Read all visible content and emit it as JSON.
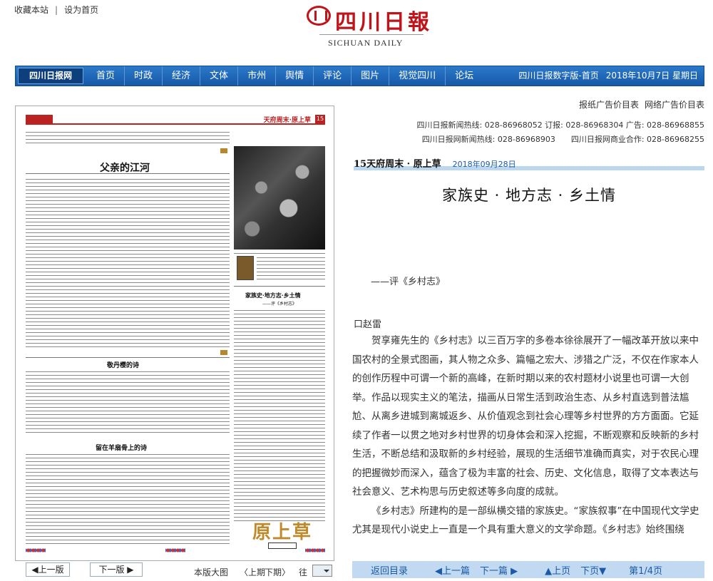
{
  "top_links": {
    "bookmark": "收藏本站",
    "separator": "|",
    "set_home": "设为首页"
  },
  "logo": {
    "cn": "四川日報",
    "en": "SICHUAN DAILY"
  },
  "nav": {
    "brand": "四川日报网",
    "items": [
      "首页",
      "时政",
      "经济",
      "文体",
      "市州",
      "舆情",
      "评论",
      "图片",
      "视觉四川",
      "论坛"
    ],
    "edition": "四川日报数字版-首页",
    "date": "2018年10月7日 星期日"
  },
  "ad_links": [
    "报纸广告价目表",
    "网络广告价目表"
  ],
  "hotlines": {
    "line1": "四川日报新闻热线: 028-86968052 订报: 028-86968304 广告: 028-86968855",
    "line2": "四川日报网新闻热线: 028-86968903　　四川日报网商业合作: 028-86968255"
  },
  "paper_page": {
    "header_right": "天府周末·原上草",
    "page_no": "15",
    "headline1": "父亲的江河",
    "headline2": "家族史·地方志·乡土情",
    "headline2_sub": "——评《乡村志》",
    "headline3": "敬丹樱的诗",
    "headline4": "留在羊扇骨上的诗",
    "seal_text": "原上草"
  },
  "page_nav": {
    "prev": "◀上一版",
    "next": "下一版 ▶",
    "big_image": "本版大图",
    "prev_period": "〈上期",
    "next_period": "下期〉",
    "go": "往"
  },
  "article": {
    "section": "15天府周末 · 原上草",
    "section_date": "2018年09月28日",
    "title": "家族史 · 地方志 · 乡土情",
    "subtitle": "——评《乡村志》",
    "author": "口赵雷",
    "paragraph1": "贺享雍先生的《乡村志》以三百万字的多卷本徐徐展开了一幅改革开放以来中国农村的全景式图画，其人物之众多、篇幅之宏大、涉猎之广泛，不仅在作家本人的创作历程中可谓一个新的高峰，在新时期以来的农村题材小说里也可谓一大创举。作品以现实主义的笔法，描画从日常生活到政治生态、从乡村直选到普法尴尬、从离乡进城到离城返乡、从价值观念到社会心理等乡村世界的方方面面。它延续了作者一以贯之地对乡村世界的切身体会和深入挖掘，不断观察和反映新的乡村生活，不断总结和汲取新的乡村经验，展现的生活细节准确而真实，对于农民心理的把握微妙而深入，蕴含了极为丰富的社会、历史、文化信息，取得了文本表达与社会意义、艺术构思与历史叙述等多向度的成就。",
    "paragraph2": "《乡村志》所建构的是一部纵横交错的家族史。“家族叙事”在中国现代文学史尤其是现代小说史上一直是一个具有重大意义的文学命题。《乡村志》始终围绕"
  },
  "bottom_bar": {
    "back": "返回目录",
    "prev_article": "◀上一篇",
    "next_article": "下一篇 ▶",
    "prev_page": "▲上页",
    "next_page": "下页▼",
    "page_count": "第1/4页"
  },
  "colors": {
    "nav_blue": "#1a64b5",
    "logo_red": "#c0131a",
    "link_blue": "#1a5aa6",
    "bar_blue": "#c2d9f2"
  }
}
